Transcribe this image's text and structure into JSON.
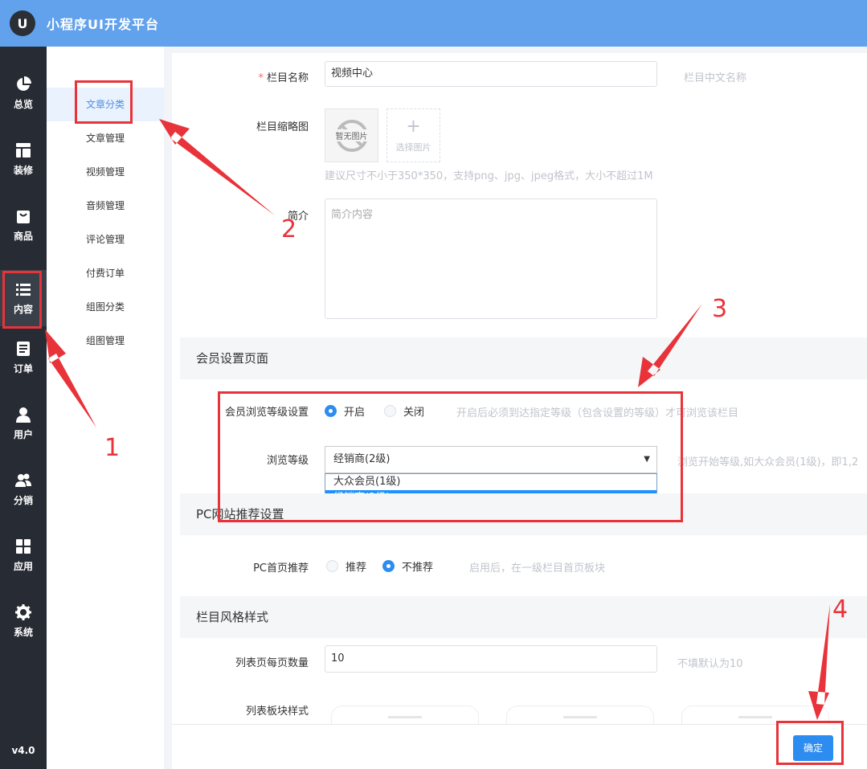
{
  "header": {
    "logo_letter": "U",
    "title": "小程序UI开发平台"
  },
  "nav": {
    "items": [
      {
        "label": "总览",
        "icon": "pie-chart-icon"
      },
      {
        "label": "装修",
        "icon": "layout-icon"
      },
      {
        "label": "商品",
        "icon": "shopping-bag-icon"
      },
      {
        "label": "内容",
        "icon": "list-icon",
        "active": true
      },
      {
        "label": "订单",
        "icon": "document-icon"
      },
      {
        "label": "用户",
        "icon": "user-icon"
      },
      {
        "label": "分销",
        "icon": "users-icon"
      },
      {
        "label": "应用",
        "icon": "grid-icon"
      },
      {
        "label": "系统",
        "icon": "gear-icon"
      }
    ],
    "version": "v4.0"
  },
  "subnav": {
    "items": [
      {
        "label": "文章分类",
        "active": true
      },
      {
        "label": "文章管理"
      },
      {
        "label": "视频管理"
      },
      {
        "label": "音频管理"
      },
      {
        "label": "评论管理"
      },
      {
        "label": "付费订单"
      },
      {
        "label": "组图分类"
      },
      {
        "label": "组图管理"
      }
    ]
  },
  "form": {
    "name_label": "栏目名称",
    "name_value": "视频中心",
    "name_hint": "栏目中文名称",
    "thumb_label": "栏目缩略图",
    "thumb_placeholder": "暂无图片",
    "thumb_select": "选择图片",
    "thumb_hint": "建议尺寸不小于350*350，支持png、jpg、jpeg格式，大小不超过1M",
    "intro_label": "简介",
    "intro_placeholder": "简介内容"
  },
  "member": {
    "section_title": "会员设置页面",
    "level_label": "会员浏览等级设置",
    "on_label": "开启",
    "off_label": "关闭",
    "level_hint": "开启后必须到达指定等级（包含设置的等级）才可浏览该栏目",
    "browse_label": "浏览等级",
    "browse_selected": "经销商(2级)",
    "browse_hint": "浏览开始等级,如大众会员(1级)，即1,2",
    "options": [
      "大众会员(1级)",
      "经销商(2级)"
    ]
  },
  "pc": {
    "section_title": "PC网站推荐设置",
    "home_label": "PC首页推荐",
    "recommend_label": "推荐",
    "not_recommend_label": "不推荐",
    "home_hint": "启用后，在一级栏目首页板块"
  },
  "style": {
    "section_title": "栏目风格样式",
    "page_size_label": "列表页每页数量",
    "page_size_value": "10",
    "page_size_hint": "不填默认为10",
    "block_label": "列表板块样式"
  },
  "footer": {
    "ok_label": "确定"
  },
  "annotations": {
    "n1": "1",
    "n2": "2",
    "n3": "3",
    "n4": "4"
  },
  "colors": {
    "accent": "#2d8cf0",
    "topbar": "#62a2ec",
    "nav_bg": "#272c34",
    "annotation": "#e8333a"
  }
}
